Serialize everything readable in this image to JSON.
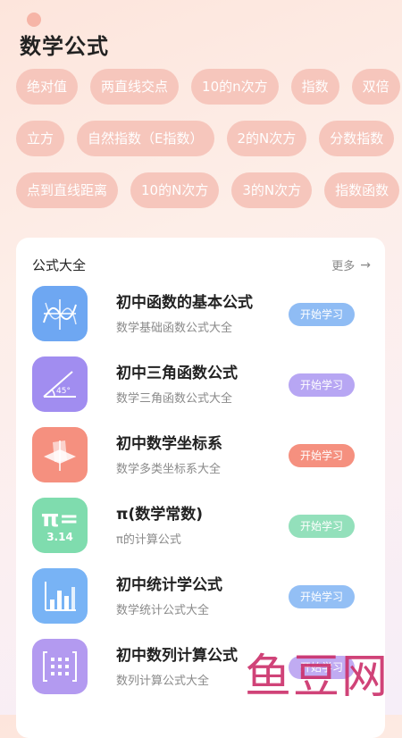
{
  "app": {
    "title": "数学公式"
  },
  "chips": [
    [
      "绝对值",
      "两直线交点",
      "10的n次方",
      "指数",
      "双倍"
    ],
    [
      "立方",
      "自然指数（E指数）",
      "2的N次方",
      "分数指数"
    ],
    [
      "点到直线距离",
      "10的N次方",
      "3的N次方",
      "指数函数"
    ]
  ],
  "section": {
    "title": "公式大全",
    "more_label": "更多"
  },
  "items": [
    {
      "title": "初中函数的基本公式",
      "subtitle": "数学基础函数公式大全",
      "button": "开始学习",
      "icon": "function-graph-icon",
      "color": "#6ea7f2",
      "button_color": "#8fbcf4"
    },
    {
      "title": "初中三角函数公式",
      "subtitle": "数学三角函数公式大全",
      "button": "开始学习",
      "icon": "angle-icon",
      "color": "#a18df0",
      "button_color": "#b7a6f3"
    },
    {
      "title": "初中数学坐标系",
      "subtitle": "数学多类坐标系大全",
      "button": "开始学习",
      "icon": "coordinate-icon",
      "color": "#f5907f",
      "button_color": "#f5907f"
    },
    {
      "title": "π(数学常数)",
      "subtitle": "π的计算公式",
      "button": "开始学习",
      "icon": "pi-icon",
      "color": "#7fdcae",
      "button_color": "#93e0bb",
      "pi_label": "π=",
      "pi_value": "3.14"
    },
    {
      "title": "初中统计学公式",
      "subtitle": "数学统计公式大全",
      "button": "开始学习",
      "icon": "bar-chart-icon",
      "color": "#78b3f5",
      "button_color": "#93bff5"
    },
    {
      "title": "初中数列计算公式",
      "subtitle": "数列计算公式大全",
      "button": "开始学习",
      "icon": "matrix-icon",
      "color": "#b39af0",
      "button_color": "#c0abf2"
    }
  ],
  "watermark": "鱼豆网"
}
